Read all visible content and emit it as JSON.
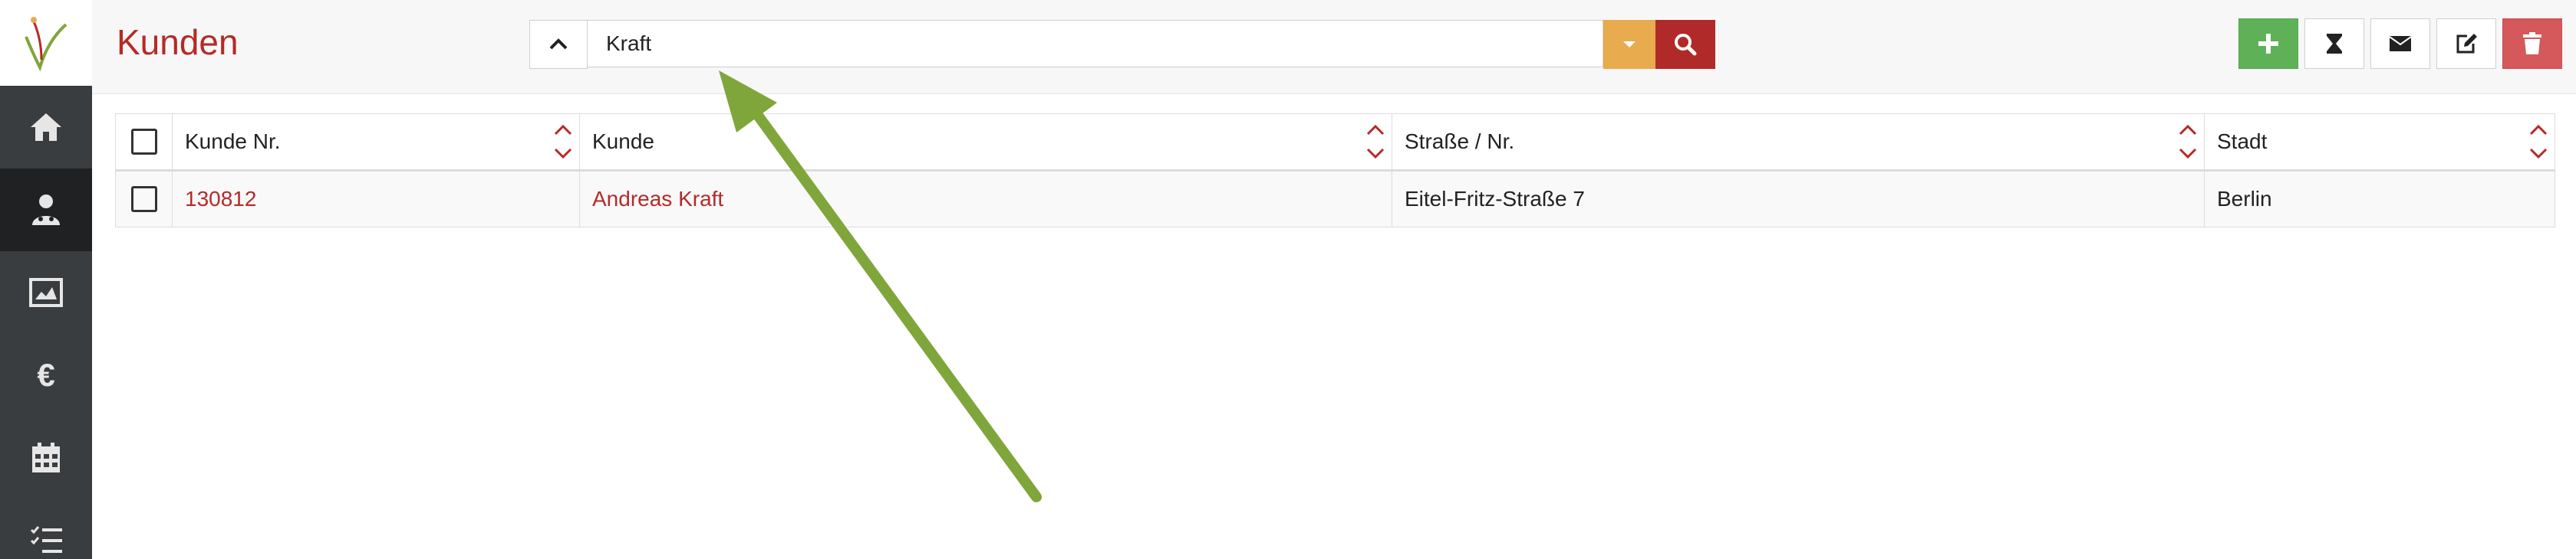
{
  "header": {
    "title": "Kunden"
  },
  "search": {
    "value": "Kraft"
  },
  "table": {
    "columns": [
      "Kunde Nr.",
      "Kunde",
      "Straße / Nr.",
      "Stadt"
    ],
    "rows": [
      {
        "kunde_nr": "130812",
        "kunde": "Andreas Kraft",
        "strasse": "Eitel-Fritz-Straße 7",
        "stadt": "Berlin"
      }
    ]
  },
  "sidebar": {
    "items": [
      "home-icon",
      "customers-icon",
      "image-icon",
      "euro-icon",
      "calendar-icon",
      "tasks-icon"
    ]
  },
  "toolbar": {
    "buttons": [
      "add-icon",
      "hourglass-icon",
      "envelope-icon",
      "edit-icon",
      "trash-icon"
    ]
  },
  "colors": {
    "brand_red": "#b52a26",
    "sidebar_bg": "#3a3d40",
    "filter_orange": "#e8ab4e",
    "add_green": "#5fb157",
    "delete_red": "#d5585a",
    "annotation_green": "#7fa63a"
  }
}
